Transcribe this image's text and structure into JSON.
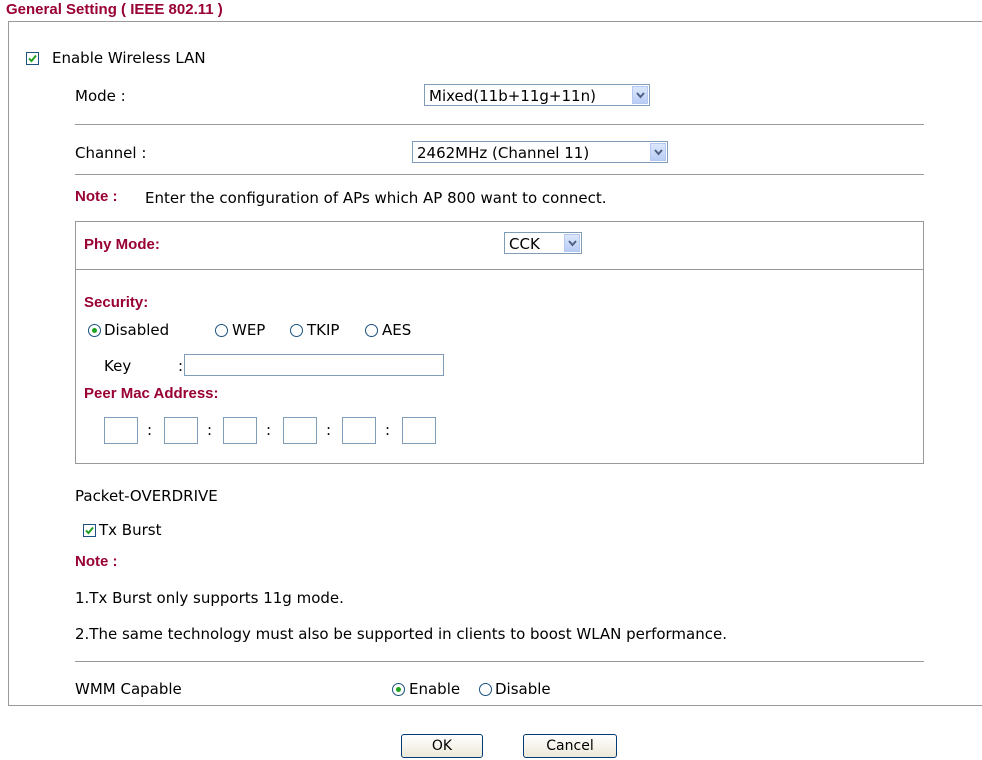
{
  "section_title": "General Setting ( IEEE 802.11 )",
  "enable_wireless": {
    "label": "Enable Wireless LAN",
    "checked": true
  },
  "mode": {
    "label": "Mode :",
    "value": "Mixed(11b+11g+11n)"
  },
  "channel": {
    "label": "Channel :",
    "value": "2462MHz (Channel 11)"
  },
  "note1": {
    "label": "Note :",
    "text": "Enter the configuration of APs which AP 800 want to connect."
  },
  "phy_mode": {
    "label": "Phy Mode:",
    "value": "CCK"
  },
  "security": {
    "label": "Security:",
    "options": [
      "Disabled",
      "WEP",
      "TKIP",
      "AES"
    ],
    "selected": "Disabled",
    "key_label": "Key",
    "key_sep": ":",
    "key_value": ""
  },
  "peer_mac": {
    "label": "Peer Mac Address:",
    "separator": ":",
    "octets": [
      "",
      "",
      "",
      "",
      "",
      ""
    ]
  },
  "packet_overdrive": {
    "label": "Packet-OVERDRIVE",
    "tx_burst_label": "Tx Burst",
    "tx_burst_checked": true
  },
  "note2": {
    "label": "Note :",
    "line1": "1.Tx Burst only supports 11g mode.",
    "line2": "2.The same technology must also be supported in clients to boost WLAN performance."
  },
  "wmm": {
    "label": "WMM Capable",
    "options": [
      "Enable",
      "Disable"
    ],
    "selected": "Enable"
  },
  "buttons": {
    "ok": "OK",
    "cancel": "Cancel"
  },
  "colors": {
    "accent": "#990033",
    "check": "#21a121",
    "border": "#999999"
  }
}
